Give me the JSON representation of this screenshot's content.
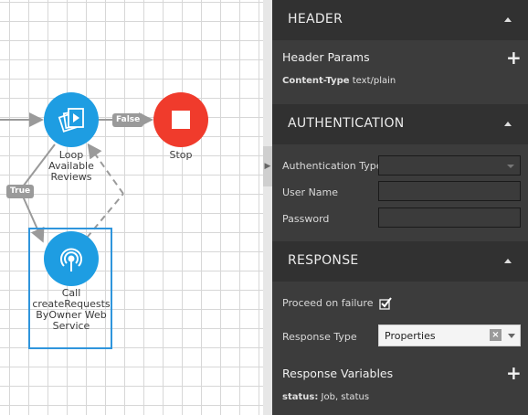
{
  "flow": {
    "node_loop_label": "Loop Available Reviews",
    "node_stop_label": "Stop",
    "node_call_label": "Call createRequests ByOwner Web Service",
    "edge_false": "False",
    "edge_true": "True",
    "colors": {
      "node_blue": "#1e9de2",
      "node_red": "#f03b2c",
      "selection": "#2f95dc"
    }
  },
  "panel": {
    "header": {
      "title": "HEADER",
      "params_label": "Header Params",
      "content_type_key": "Content-Type",
      "content_type_value": "text/plain"
    },
    "authentication": {
      "title": "AUTHENTICATION",
      "auth_type_label": "Authentication Type",
      "auth_type_value": "",
      "username_label": "User Name",
      "username_value": "",
      "password_label": "Password",
      "password_value": ""
    },
    "response": {
      "title": "RESPONSE",
      "proceed_label": "Proceed on failure",
      "proceed_checked": true,
      "type_label": "Response Type",
      "type_value": "Properties",
      "variables_label": "Response Variables",
      "var_key": "status:",
      "var_value": "Job,  status"
    }
  }
}
